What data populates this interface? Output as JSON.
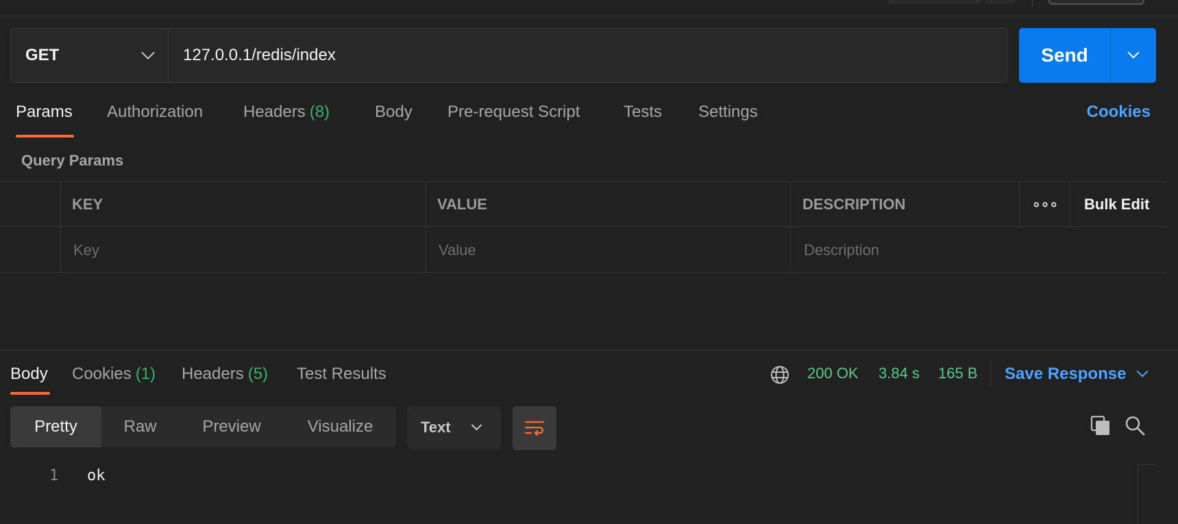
{
  "request": {
    "method": "GET",
    "url": "127.0.0.1/redis/index",
    "send_label": "Send"
  },
  "request_tabs": [
    {
      "label": "Params",
      "count": "",
      "active": true
    },
    {
      "label": "Authorization",
      "count": ""
    },
    {
      "label": "Headers",
      "count": "(8)"
    },
    {
      "label": "Body",
      "count": ""
    },
    {
      "label": "Pre-request Script",
      "count": ""
    },
    {
      "label": "Tests",
      "count": ""
    },
    {
      "label": "Settings",
      "count": ""
    }
  ],
  "cookies_link": "Cookies",
  "query_params": {
    "section_label": "Query Params",
    "headers": {
      "key": "KEY",
      "value": "VALUE",
      "description": "DESCRIPTION",
      "more": "∘∘∘",
      "bulk_edit": "Bulk Edit"
    },
    "placeholders": {
      "key": "Key",
      "value": "Value",
      "description": "Description"
    }
  },
  "response_tabs": [
    {
      "label": "Body",
      "count": "",
      "active": true
    },
    {
      "label": "Cookies",
      "count": "(1)"
    },
    {
      "label": "Headers",
      "count": "(5)"
    },
    {
      "label": "Test Results",
      "count": ""
    }
  ],
  "response_meta": {
    "status": "200 OK",
    "time": "3.84 s",
    "size": "165 B",
    "save_label": "Save Response"
  },
  "view_modes": [
    "Pretty",
    "Raw",
    "Preview",
    "Visualize"
  ],
  "format": "Text",
  "code": {
    "line_number": "1",
    "text": "ok"
  },
  "colors": {
    "accent_orange": "#ff6c37",
    "send_blue": "#097bed",
    "link_blue": "#4da3ff",
    "status_green": "#5cc98a",
    "background": "#212121"
  },
  "icons": [
    "globe-icon",
    "copy-icon",
    "search-icon",
    "wrap-lines-icon",
    "chevron-down-icon"
  ]
}
